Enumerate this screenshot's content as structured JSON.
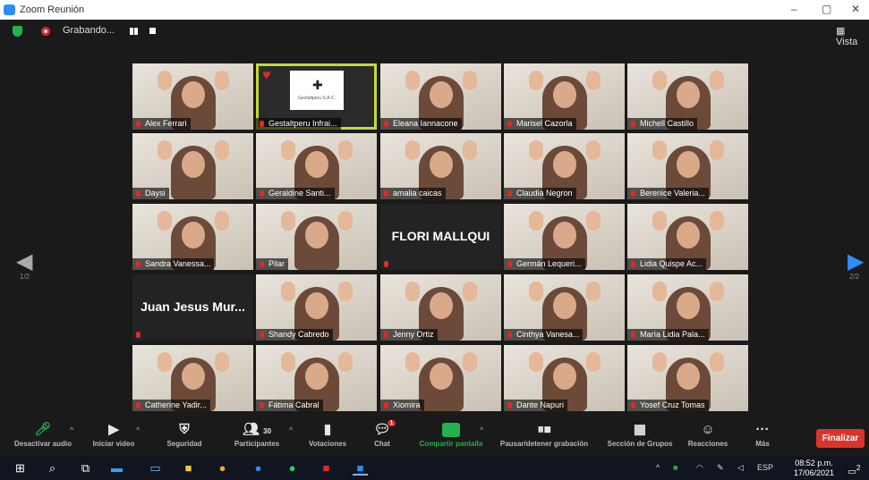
{
  "window": {
    "title": "Zoom Reunión",
    "minimize": "–",
    "maximize": "▢",
    "close": "✕"
  },
  "top": {
    "recording_label": "Grabando...",
    "view_label": "Vista"
  },
  "pager": {
    "left": "1/2",
    "right": "2/2"
  },
  "participants": [
    {
      "name": "Alex Ferrari",
      "type": "video"
    },
    {
      "name": "Gestaltperu Infrai...",
      "type": "logo",
      "logo_caption": "Gestaltperu S.A.C.",
      "active": true
    },
    {
      "name": "Eleana Iannacone",
      "type": "video"
    },
    {
      "name": "Marisel Cazorla",
      "type": "video"
    },
    {
      "name": "Michell Castillo",
      "type": "video"
    },
    {
      "name": "Daysi",
      "type": "video"
    },
    {
      "name": "Geraldine Santi...",
      "type": "video"
    },
    {
      "name": "amalia caicas",
      "type": "video"
    },
    {
      "name": "Claudia Negron",
      "type": "video"
    },
    {
      "name": "Berenice Valeria...",
      "type": "video"
    },
    {
      "name": "Sandra Vanessa...",
      "type": "video"
    },
    {
      "name": "Pilar",
      "type": "video"
    },
    {
      "name": "FLORI MALLQUI",
      "type": "name"
    },
    {
      "name": "Germán Lequeri...",
      "type": "video"
    },
    {
      "name": "Lidia Quispe Ac...",
      "type": "video"
    },
    {
      "name": "Juan Jesus Mur...",
      "type": "name"
    },
    {
      "name": "Shandy Cabredo",
      "type": "video"
    },
    {
      "name": "Jenny Ortiz",
      "type": "video"
    },
    {
      "name": "Cinthya Vanesa...",
      "type": "video"
    },
    {
      "name": "María Lidia Pala...",
      "type": "video"
    },
    {
      "name": "Catherine Yadir...",
      "type": "video"
    },
    {
      "name": "Fátima Cabral",
      "type": "video"
    },
    {
      "name": "Xiomira",
      "type": "video"
    },
    {
      "name": "Dante Napuri",
      "type": "video"
    },
    {
      "name": "Yosef Cruz Tomas",
      "type": "video"
    }
  ],
  "toolbar": {
    "audio": "Desactivar audio",
    "video": "Iniciar video",
    "security": "Seguridad",
    "participants": "Participantes",
    "participants_count": "30",
    "polls": "Votaciones",
    "chat": "Chat",
    "chat_badge": "1",
    "share": "Compartir pantalla",
    "record": "Pausar/detener grabación",
    "breakout": "Sección de Grupos",
    "reactions": "Reacciones",
    "more": "Más",
    "end": "Finalizar"
  },
  "taskbar": {
    "lang": "ESP",
    "time": "08:52 p.m.",
    "date": "17/06/2021",
    "notif": "2"
  }
}
